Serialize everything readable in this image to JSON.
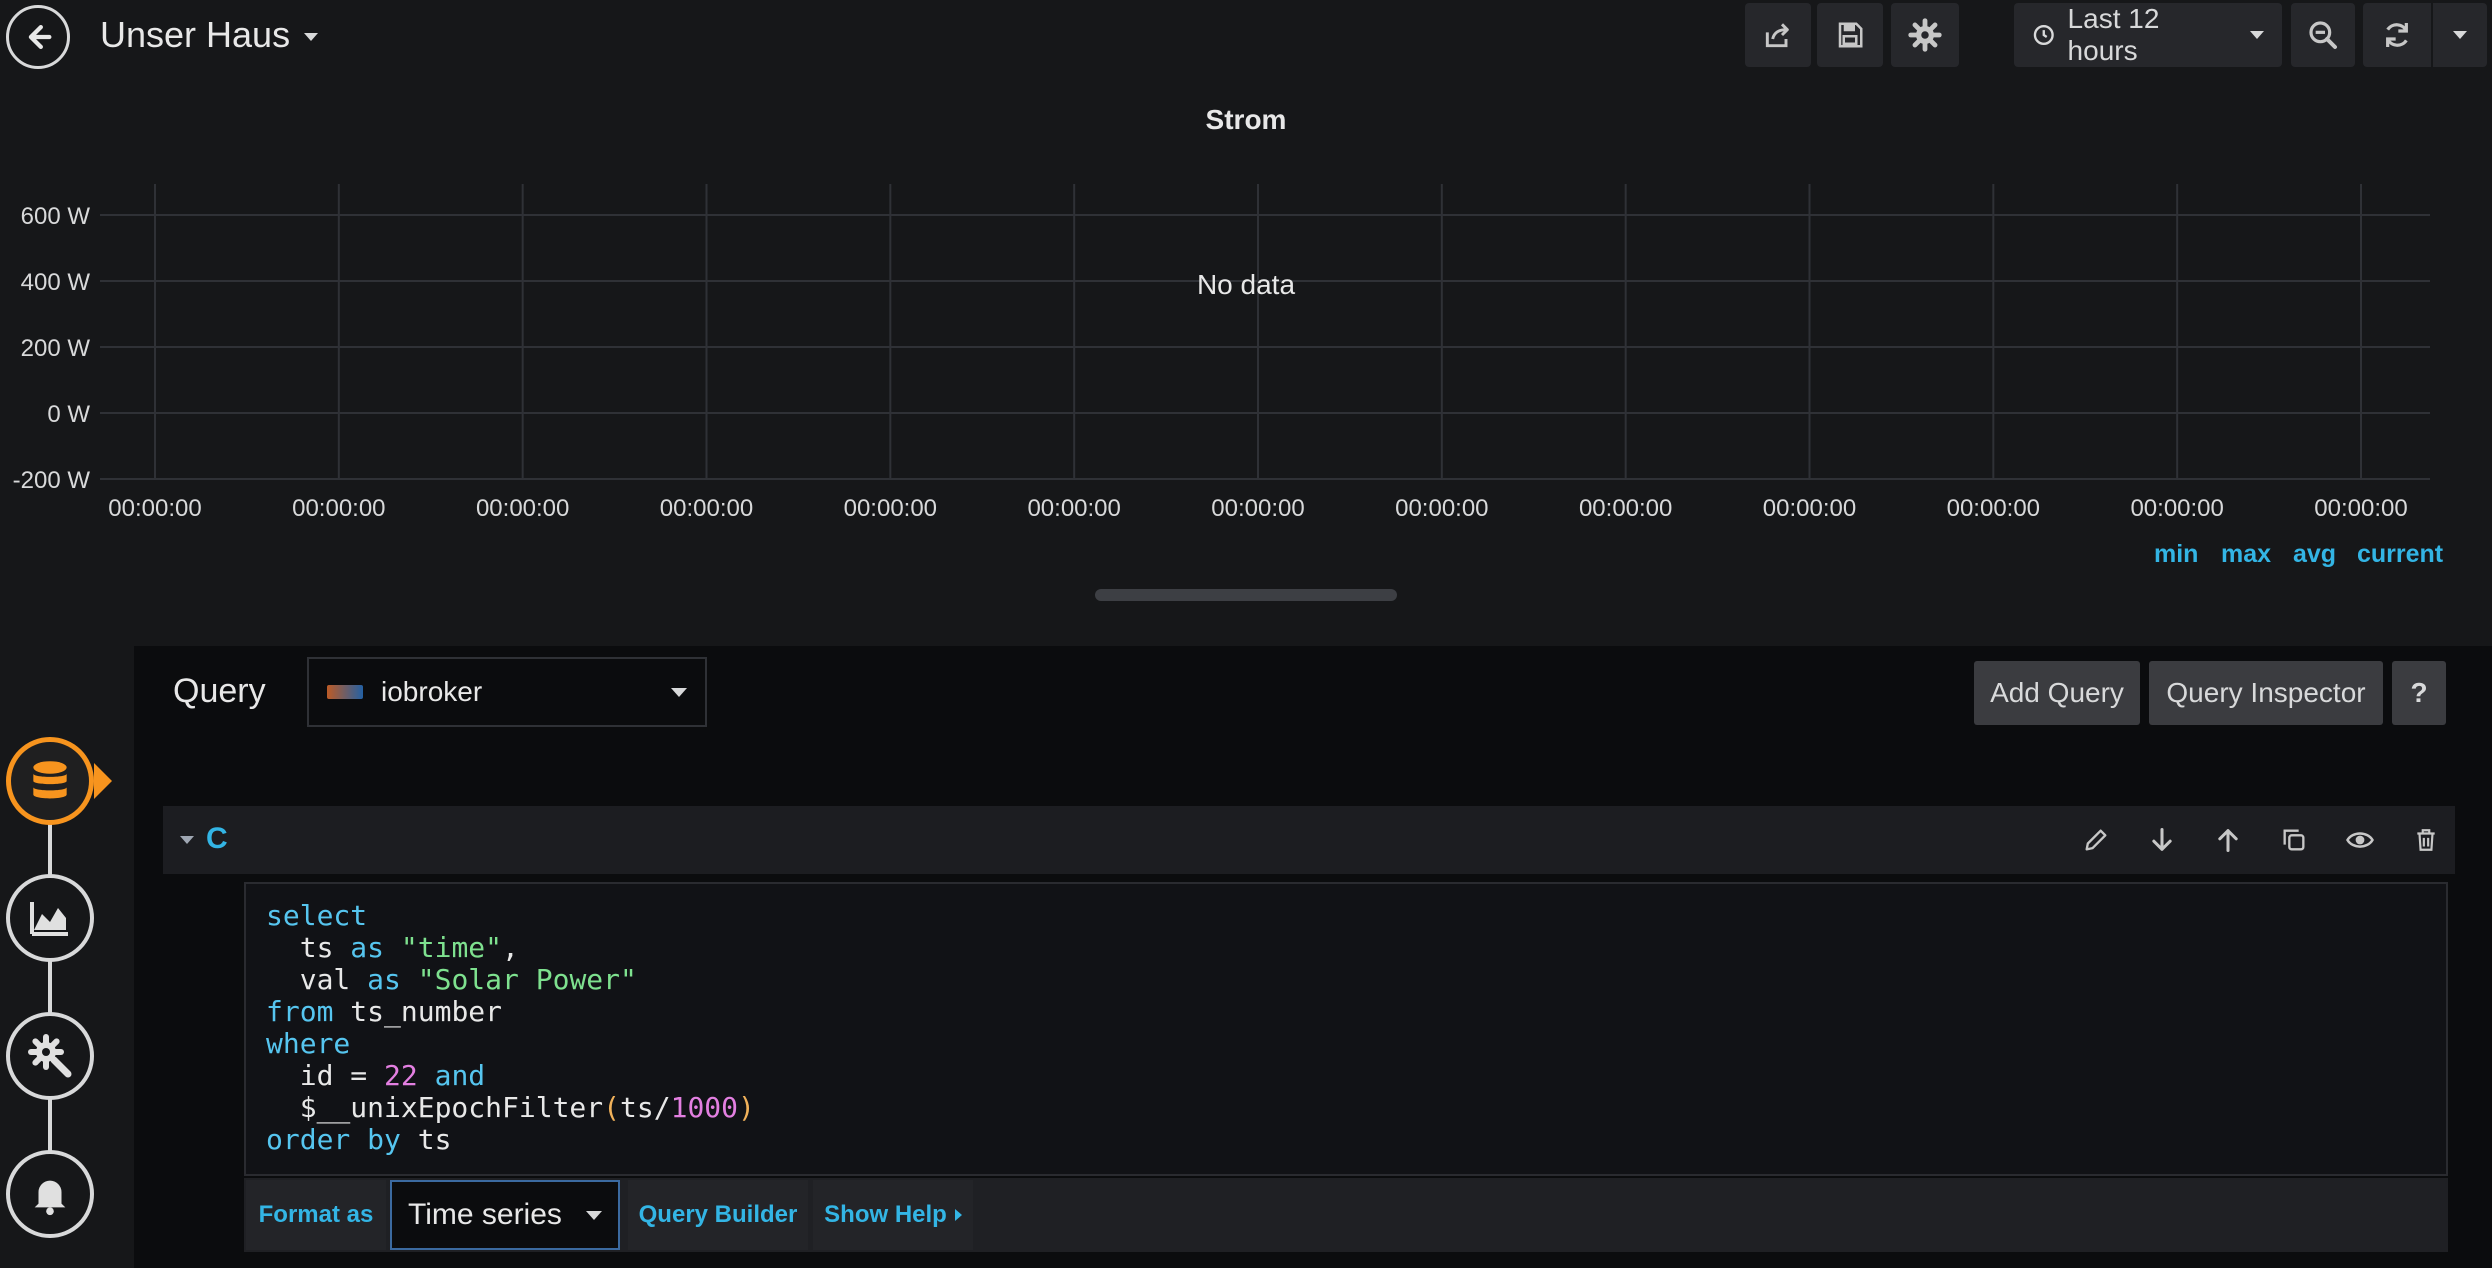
{
  "header": {
    "title": "Unser Haus",
    "time_range": "Last 12 hours",
    "icons": [
      "back-arrow-icon",
      "share-icon",
      "save-icon",
      "gear-icon",
      "clock-icon",
      "zoom-out-icon",
      "refresh-icon",
      "chevron-down-icon"
    ]
  },
  "panel": {
    "title": "Strom",
    "no_data": "No data",
    "legend": [
      "min",
      "max",
      "avg",
      "current"
    ]
  },
  "chart_data": {
    "type": "line",
    "title": "Strom",
    "series": [],
    "y_ticks": [
      "600 W",
      "400 W",
      "200 W",
      "0 W",
      "-200 W"
    ],
    "x_ticks": [
      "00:00:00",
      "00:00:00",
      "00:00:00",
      "00:00:00",
      "00:00:00",
      "00:00:00",
      "00:00:00",
      "00:00:00",
      "00:00:00",
      "00:00:00",
      "00:00:00",
      "00:00:00",
      "00:00:00"
    ],
    "ylim": [
      -200,
      600
    ],
    "grid": true
  },
  "query": {
    "label": "Query",
    "datasource": "iobroker",
    "add_query": "Add Query",
    "query_inspector": "Query Inspector",
    "help": "?",
    "ref_id": "C",
    "format_as_label": "Format as",
    "format_value": "Time series",
    "query_builder": "Query Builder",
    "show_help": "Show Help"
  },
  "sql_lines": [
    [
      {
        "t": "select",
        "c": "kw"
      }
    ],
    [
      {
        "t": "  ts ",
        "c": ""
      },
      {
        "t": "as",
        "c": "kw"
      },
      {
        "t": " ",
        "c": ""
      },
      {
        "t": "\"time\"",
        "c": "str"
      },
      {
        "t": ",",
        "c": ""
      }
    ],
    [
      {
        "t": "  val ",
        "c": ""
      },
      {
        "t": "as",
        "c": "kw"
      },
      {
        "t": " ",
        "c": ""
      },
      {
        "t": "\"Solar Power\"",
        "c": "str"
      }
    ],
    [
      {
        "t": "from",
        "c": "kw"
      },
      {
        "t": " ts_number",
        "c": ""
      }
    ],
    [
      {
        "t": "where",
        "c": "kw"
      }
    ],
    [
      {
        "t": "  id = ",
        "c": ""
      },
      {
        "t": "22",
        "c": "num"
      },
      {
        "t": " ",
        "c": ""
      },
      {
        "t": "and",
        "c": "kw"
      }
    ],
    [
      {
        "t": "  $__unixEpochFilter",
        "c": ""
      },
      {
        "t": "(",
        "c": "paren"
      },
      {
        "t": "ts/",
        "c": ""
      },
      {
        "t": "1000",
        "c": "num"
      },
      {
        "t": ")",
        "c": "paren"
      }
    ],
    [
      {
        "t": "order by",
        "c": "kw"
      },
      {
        "t": " ts",
        "c": ""
      }
    ]
  ],
  "colors": {
    "accent": "#33b5e5",
    "nav_active": "#f7941e",
    "background": "#161719"
  }
}
